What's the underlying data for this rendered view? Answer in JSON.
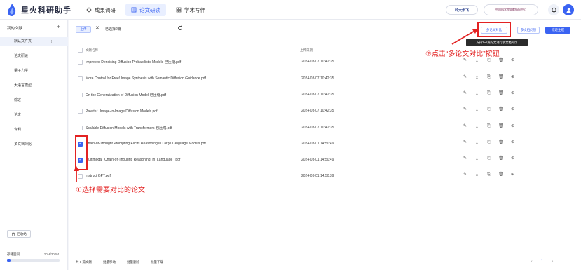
{
  "app": {
    "name": "星火科研助手"
  },
  "nav": [
    {
      "label": "成果调研",
      "active": false
    },
    {
      "label": "论文研读",
      "active": true
    },
    {
      "label": "学术写作",
      "active": false
    }
  ],
  "header": {
    "brand1": "科大讯飞",
    "brand2": "中国科学院文献情报中心"
  },
  "sidebar": {
    "title": "我的文献",
    "add": "+",
    "items": [
      {
        "label": "默认文件夹",
        "active": true
      },
      {
        "label": "论文研读",
        "active": false
      },
      {
        "label": "量子力学",
        "active": false
      },
      {
        "label": "大语言模型",
        "active": false
      },
      {
        "label": "综述",
        "active": false
      },
      {
        "label": "论文",
        "active": false
      },
      {
        "label": "专利",
        "active": false
      },
      {
        "label": "多文档对比",
        "active": false
      }
    ],
    "recycle": "回收站",
    "storage_label": "存储空间",
    "storage_value": "20M/300M",
    "storage_fraction": 0.067
  },
  "toolbar": {
    "upload": "上传",
    "close": "✕",
    "selected": "已选择2篇",
    "compare_btn": "多论文对比",
    "multi_btn": "多文档问答",
    "gen_btn": "综述生成",
    "tooltip": "支持2~5篇论文进行多文档对比"
  },
  "table": {
    "col_name": "文献名称",
    "col_date": "上传日期",
    "rows": [
      {
        "name": "Improved Denoising Diffusion Probabilistic Models-已压缩.pdf",
        "date": "2024-03-07 10:42:35",
        "checked": false
      },
      {
        "name": "More Control for Free! Image Synthesis with Semantic Diffusion Guidance.pdf",
        "date": "2024-03-07 10:42:35",
        "checked": false
      },
      {
        "name": "On the Generalization of Diffusion Model-已压缩.pdf",
        "date": "2024-03-07 10:42:35",
        "checked": false
      },
      {
        "name": "Palette：Image-to-Image Diffusion Models.pdf",
        "date": "2024-03-07 10:42:35",
        "checked": false
      },
      {
        "name": "Scalable Diffusion Models with Transformers-已压缩.pdf",
        "date": "2024-03-07 10:42:35",
        "checked": false
      },
      {
        "name": "Chain-of-Thought Prompting Elicits Reasoning in Large Language Models.pdf",
        "date": "2024-03-01 14:50:49",
        "checked": true
      },
      {
        "name": "Multimodal_Chain-of-Thought_Reasoning_in_Language_.pdf",
        "date": "2024-03-01 14:50:49",
        "checked": true
      },
      {
        "name": "Instruct GPT.pdf",
        "date": "2024-03-01 14:50:39",
        "checked": false
      }
    ]
  },
  "annotations": {
    "step1": "①选择需要对比的论文",
    "step2": "②点击“多论文对比”按钮"
  },
  "footer": {
    "count": "共 8 篇文献",
    "batch_move": "批量移动",
    "batch_delete": "批量删除",
    "batch_download": "批量下载"
  },
  "pager": {
    "prev": "‹",
    "current": "1",
    "next": "›"
  }
}
